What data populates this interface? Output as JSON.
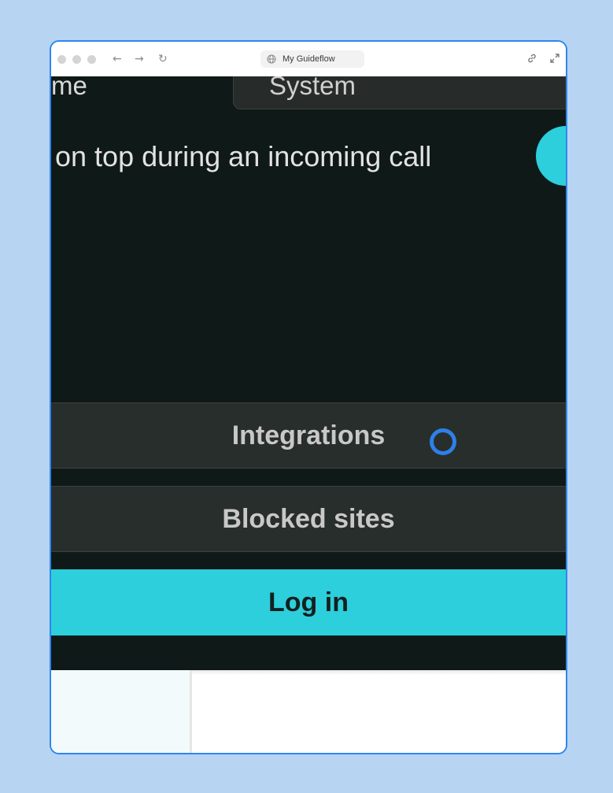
{
  "browser": {
    "url_title": "My Guideflow",
    "icons": [
      "back-arrow-icon",
      "forward-arrow-icon",
      "reload-icon",
      "globe-icon",
      "link-icon",
      "expand-icon"
    ]
  },
  "app": {
    "theme_label_partial": "me",
    "theme_value": "System",
    "setting_text": "on top during an incoming call",
    "toggle_on": true,
    "buttons": {
      "integrations": "Integrations",
      "blocked_sites": "Blocked sites",
      "login": "Log in"
    }
  },
  "colors": {
    "frame_bg": "#b7d4f3",
    "browser_border": "#2f86f0",
    "app_bg": "#0f1917",
    "accent": "#2ccfdb",
    "dark_button": "#272e2b",
    "cursor": "#2f7fe8"
  }
}
